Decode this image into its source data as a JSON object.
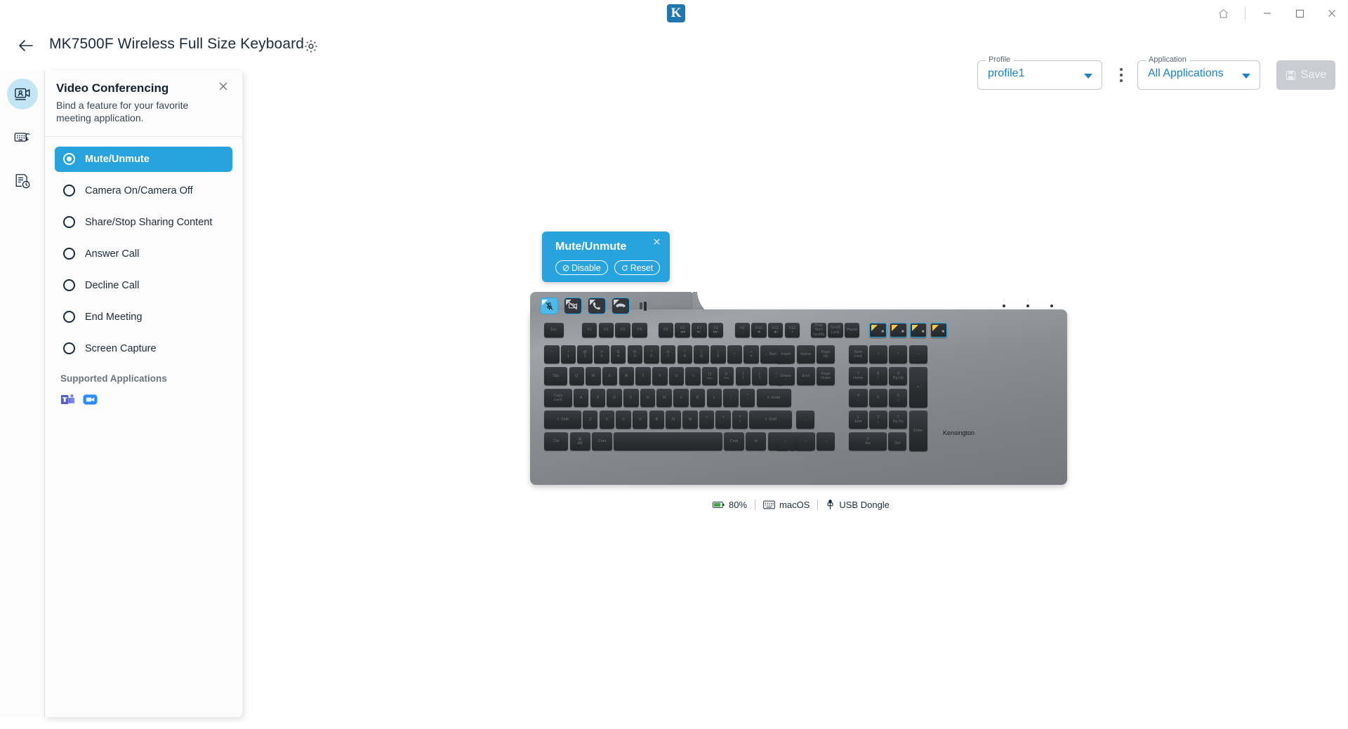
{
  "window": {
    "logo_text": "K",
    "controls": [
      {
        "name": "home",
        "label": "Home"
      },
      {
        "name": "minimize",
        "label": "Minimize"
      },
      {
        "name": "maximize",
        "label": "Maximize"
      },
      {
        "name": "close",
        "label": "Close"
      }
    ]
  },
  "header": {
    "back_label": "Back",
    "title": "MK7500F Wireless Full Size Keyboard",
    "settings_label": "Settings",
    "profile": {
      "label": "Profile",
      "value": "profile1"
    },
    "application": {
      "label": "Application",
      "value": "All Applications"
    },
    "more_label": "More options",
    "save_label": "Save"
  },
  "rail": {
    "items": [
      {
        "name": "video-conferencing",
        "icon": "video-conference-icon",
        "active": true
      },
      {
        "name": "keyboard-customization",
        "icon": "keyboard-edit-icon",
        "active": false
      },
      {
        "name": "macro-history",
        "icon": "document-clock-icon",
        "active": false
      }
    ]
  },
  "panel": {
    "title": "Video Conferencing",
    "subtitle": "Bind a feature for your favorite meeting application.",
    "close_label": "Close",
    "options": [
      {
        "label": "Mute/Unmute",
        "selected": true
      },
      {
        "label": "Camera On/Camera Off",
        "selected": false
      },
      {
        "label": "Share/Stop Sharing Content",
        "selected": false
      },
      {
        "label": "Answer Call",
        "selected": false
      },
      {
        "label": "Decline Call",
        "selected": false
      },
      {
        "label": "End Meeting",
        "selected": false
      },
      {
        "label": "Screen Capture",
        "selected": false
      }
    ],
    "supported_title": "Supported Applications",
    "supported_apps": [
      {
        "name": "microsoft-teams",
        "label": "Microsoft Teams"
      },
      {
        "name": "zoom",
        "label": "Zoom"
      }
    ]
  },
  "tooltip": {
    "title": "Mute/Unmute",
    "close_label": "Close",
    "disable_label": "Disable",
    "reset_label": "Reset"
  },
  "keyboard": {
    "brand": "Kensington",
    "media_keys": [
      {
        "name": "mute-unmute-key",
        "icon": "microphone-muted-icon",
        "active": true
      },
      {
        "name": "camera-toggle-key",
        "icon": "camera-off-icon",
        "active": false
      },
      {
        "name": "answer-call-key",
        "icon": "phone-answer-icon",
        "active": false
      },
      {
        "name": "decline-call-key",
        "icon": "phone-hangup-icon",
        "active": false
      }
    ],
    "leds": [
      "1",
      "A",
      "↓"
    ],
    "rows": {
      "fn": [
        "Esc",
        "F1",
        "F2",
        "F3",
        "F4",
        "F5",
        "F6",
        "F7",
        "F8",
        "F9",
        "F10",
        "F11",
        "F12"
      ],
      "fn_sub": [
        "",
        "",
        "",
        "",
        "",
        "",
        "|◀◀",
        "▶||",
        "▶▶|",
        "←",
        "◀)",
        "◀))",
        "☀"
      ],
      "sys": [
        "Prnt Scrn SysRq",
        "Scroll Lock",
        "Pause"
      ],
      "highlighted": [
        "",
        "",
        "",
        ""
      ],
      "num_top": [
        "~\n`",
        "!\n1",
        "@\n2",
        "#\n3",
        "$\n4",
        "%\n5",
        "^\n6",
        "&\n7",
        "*\n8",
        "(\n9",
        ")\n0",
        "_\n-",
        "+\n="
      ],
      "backspace": "← Backspace",
      "qwerty": [
        "Q",
        "W",
        "E",
        "R",
        "T",
        "Y",
        "U",
        "I",
        "O",
        "P",
        "{\n[",
        "}\n]",
        "|\n\\"
      ],
      "qwerty_sub": [
        "",
        "",
        "",
        "",
        "",
        "",
        "",
        "",
        "Mac",
        "Win",
        "",
        "",
        ""
      ],
      "tab": "Tab",
      "asdf": [
        "A",
        "S",
        "D",
        "F",
        "G",
        "H",
        "J",
        "K",
        "L",
        ":\n;",
        "\"\n'"
      ],
      "caps": "Caps Lock",
      "enter": "Enter",
      "zxcv": [
        "Z",
        "X",
        "C",
        "V",
        "B",
        "N",
        "M",
        "<\n,",
        ">\n.",
        "?\n/"
      ],
      "shift": "Shift",
      "bottom": [
        "Ctrl",
        "Alt",
        "Cmd",
        "",
        "Cmd",
        "fn",
        "☰",
        "Ctrl"
      ],
      "nav": [
        "Insert",
        "Home",
        "Page Up",
        "Delete",
        "End",
        "Page Down"
      ],
      "arrows": [
        "↑",
        "←",
        "↓",
        "→"
      ],
      "numpad": [
        "Num Lock",
        "/",
        "*",
        "−",
        "7\nHome",
        "8\n↑",
        "9\nPg Up",
        "+",
        "4\n←",
        "5",
        "6\n→",
        "1\nEnd",
        "2\n↓",
        "3\nPg Dn",
        "Enter",
        "0\nIns",
        ".\nDel"
      ]
    }
  },
  "status": {
    "battery": "80%",
    "os": "macOS",
    "connection": "USB Dongle",
    "battery_color": "#3fa93f"
  }
}
